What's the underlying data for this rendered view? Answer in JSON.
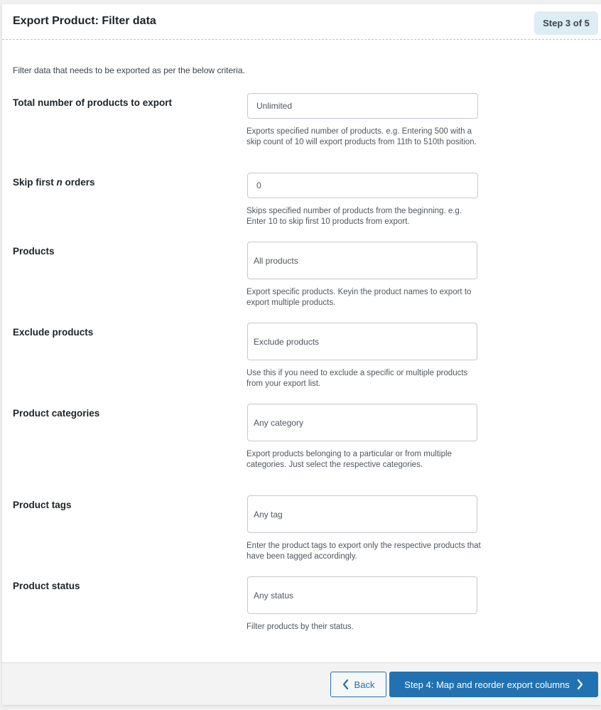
{
  "header": {
    "title": "Export Product: Filter data",
    "step_badge": "Step 3 of 5"
  },
  "intro": "Filter data that needs to be exported as per the below criteria.",
  "rows": [
    {
      "label": "Total number of products to export",
      "field_value": "Unlimited",
      "help": "Exports specified number of products. e.g. Entering 500 with a skip count of 10 will export products from 11th to 510th position."
    },
    {
      "label_pre": "Skip first ",
      "label_em": "n",
      "label_post": " orders",
      "field_value": "0",
      "help": "Skips specified number of products from the beginning. e.g. Enter 10 to skip first 10 products from export."
    },
    {
      "label": "Products",
      "field_placeholder": "All products",
      "help": "Export specific products. Keyin the product names to export to export multiple products."
    },
    {
      "label": "Exclude products",
      "field_placeholder": "Exclude products",
      "help": "Use this if you need to exclude a specific or multiple products from your export list."
    },
    {
      "label": "Product categories",
      "field_placeholder": "Any category",
      "help": "Export products belonging to a particular or from multiple categories. Just select the respective categories."
    },
    {
      "label": "Product tags",
      "field_placeholder": "Any tag",
      "help": "Enter the product tags to export only the respective products that have been tagged accordingly."
    },
    {
      "label": "Product status",
      "field_placeholder": "Any status",
      "help": "Filter products by their status."
    }
  ],
  "footer": {
    "back_label": "Back",
    "next_label": "Step 4: Map and reorder export columns"
  },
  "colors": {
    "primary": "#2271b1",
    "badge_bg": "#dcedf4",
    "footer_bg": "#f3f3f3"
  }
}
